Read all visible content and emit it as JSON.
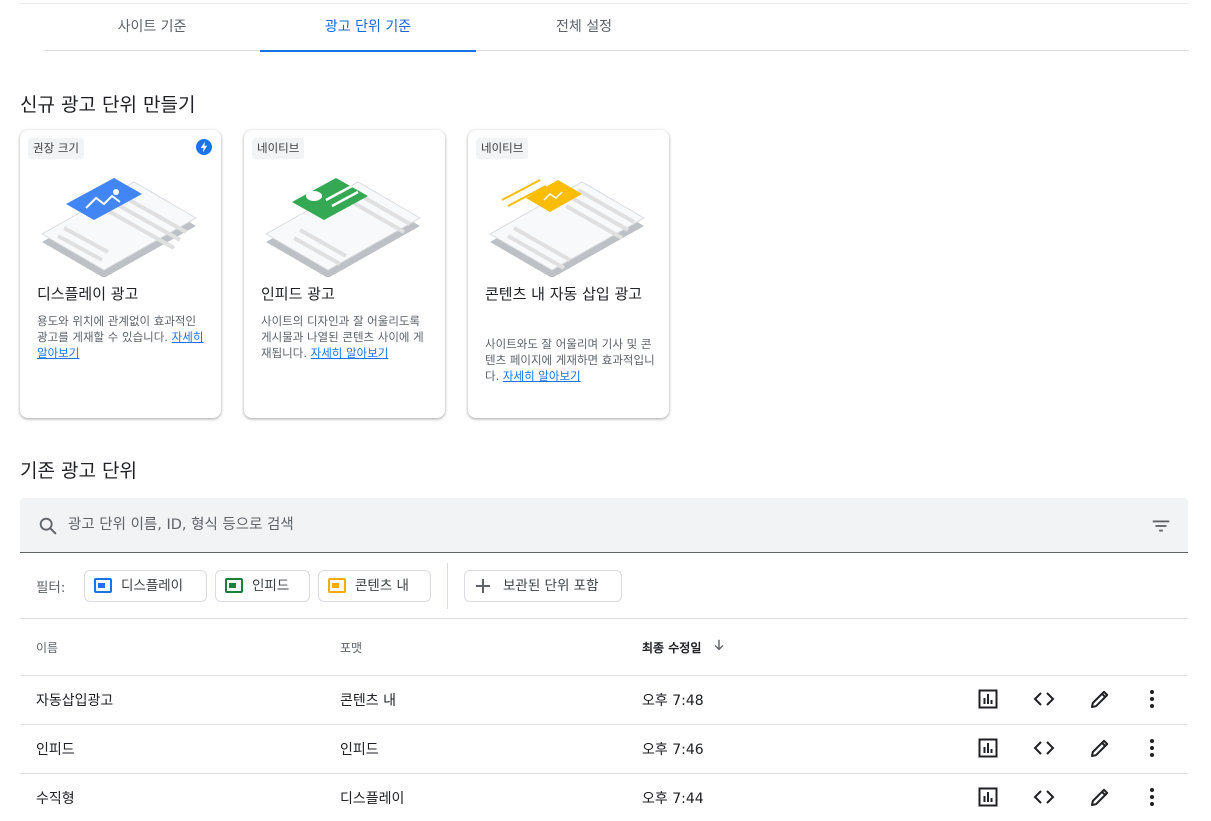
{
  "tabs": [
    {
      "label": "사이트 기준"
    },
    {
      "label": "광고 단위 기준"
    },
    {
      "label": "전체 설정"
    }
  ],
  "new_section": {
    "title": "신규 광고 단위 만들기",
    "cards": [
      {
        "badge": "권장 크기",
        "title": "디스플레이 광고",
        "desc": "용도와 위치에 관계없이 효과적인 광고를 게재할 수 있습니다.",
        "link": "자세히 알아보기"
      },
      {
        "badge": "네이티브",
        "title": "인피드 광고",
        "desc": "사이트의 디자인과 잘 어울리도록 게시물과 나열된 콘텐츠 사이에 게재됩니다.",
        "link": "자세히 알아보기"
      },
      {
        "badge": "네이티브",
        "title": "콘텐츠 내 자동 삽입 광고",
        "desc": "사이트와도 잘 어울리며 기사 및 콘텐츠 페이지에 게재하면 효과적입니다.",
        "link": "자세히 알아보기"
      }
    ]
  },
  "existing_section": {
    "title": "기존 광고 단위",
    "search_placeholder": "광고 단위 이름, ID, 형식 등으로 검색",
    "filter_label": "필터:",
    "filter_chips": [
      "디스플레이",
      "인피드",
      "콘텐츠 내"
    ],
    "archived_label": "보관된 단위 포함",
    "columns": {
      "name": "이름",
      "format": "포맷",
      "modified": "최종 수정일"
    },
    "rows": [
      {
        "name": "자동삽입광고",
        "format": "콘텐츠 내",
        "modified": "오후 7:48"
      },
      {
        "name": "인피드",
        "format": "인피드",
        "modified": "오후 7:46"
      },
      {
        "name": "수직형",
        "format": "디스플레이",
        "modified": "오후 7:44"
      }
    ]
  },
  "colors": {
    "accent": "#1a73e8",
    "display": "#4285f4",
    "infeed": "#34a853",
    "inarticle": "#fbbc04"
  }
}
